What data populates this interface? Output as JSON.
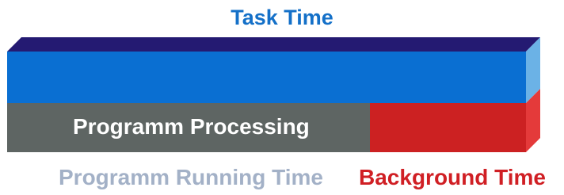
{
  "labels": {
    "task_time": "Task Time",
    "programm_processing": "Programm Processing",
    "programm_running_time": "Programm Running Time",
    "background_time": "Background Time"
  },
  "colors": {
    "task_time_text": "#1470c8",
    "blue_front": "#0a6fd2",
    "blue_top": "#241a72",
    "blue_side": "#6bb2e6",
    "gray_front": "#5e6563",
    "red_front": "#cc2122",
    "red_side": "#e43a3a",
    "processing_text": "#ffffff",
    "running_time_text": "#a3b1c7",
    "background_time_text": "#d01f24"
  },
  "segments": {
    "processing_share": 0.7
  }
}
